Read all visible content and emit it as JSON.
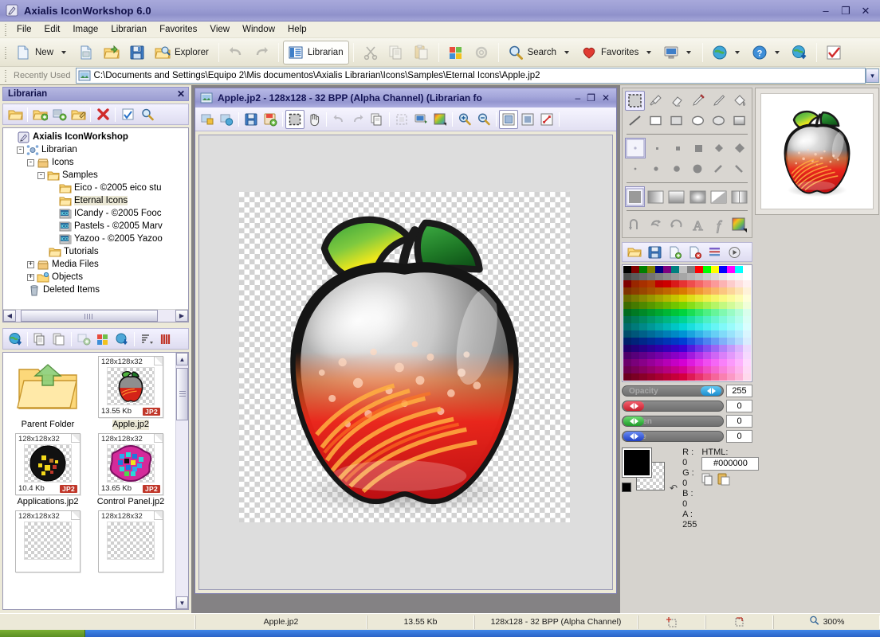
{
  "window": {
    "title": "Axialis IconWorkshop 6.0",
    "app_icon": "pen-icon",
    "minimize": "–",
    "restore": "❐",
    "close": "✕"
  },
  "menubar": {
    "items": [
      "File",
      "Edit",
      "Image",
      "Librarian",
      "Favorites",
      "View",
      "Window",
      "Help"
    ]
  },
  "toolbar": {
    "new_label": "New",
    "explorer_label": "Explorer",
    "librarian_label": "Librarian",
    "search_label": "Search",
    "favorites_label": "Favorites",
    "icons": [
      "new-document-icon",
      "new-dropdown-arrow",
      "new-from-image-icon",
      "open-folder-icon",
      "save-icon",
      "explorer-icon",
      "undo-icon",
      "redo-icon",
      "librarian-icon",
      "cut-icon",
      "copy-icon",
      "paste-icon",
      "windows-icon",
      "settings-icon",
      "search-icon",
      "favorites-heart-icon",
      "screen-icon",
      "globe-icon",
      "help-icon",
      "download-globe-icon",
      "checkmark-icon"
    ]
  },
  "address": {
    "label": "Recently Used",
    "path": "C:\\Documents and Settings\\Equipo 2\\Mis documentos\\Axialis Librarian\\Icons\\Samples\\Eternal Icons\\Apple.jp2",
    "dropdown_glyph": "▾"
  },
  "librarian_panel": {
    "caption": "Librarian",
    "close_glyph": "✕",
    "toolbar_icons": [
      "open-library-icon",
      "new-library-icon",
      "new-library-from-icon",
      "edit-library-icon",
      "delete-icon",
      "properties-icon",
      "find-icon"
    ],
    "tree": [
      {
        "indent": 0,
        "toggle": "",
        "icon": "pen-icon",
        "label": "Axialis IconWorkshop",
        "bold": true,
        "selected": false
      },
      {
        "indent": 1,
        "toggle": "-",
        "icon": "librarian-icon",
        "label": "Librarian",
        "bold": false,
        "selected": false
      },
      {
        "indent": 2,
        "toggle": "-",
        "icon": "box-icon",
        "label": "Icons",
        "bold": false,
        "selected": false
      },
      {
        "indent": 3,
        "toggle": "-",
        "icon": "folder-icon",
        "label": "Samples",
        "bold": false,
        "selected": false
      },
      {
        "indent": 4,
        "toggle": "",
        "icon": "folder-icon",
        "label": "Eico - ©2005 eico stu",
        "bold": false,
        "selected": false
      },
      {
        "indent": 4,
        "toggle": "",
        "icon": "folder-icon",
        "label": "Eternal Icons",
        "bold": false,
        "selected": true
      },
      {
        "indent": 4,
        "toggle": "",
        "icon": "ico-icon",
        "label": "ICandy - ©2005 Fooc",
        "bold": false,
        "selected": false
      },
      {
        "indent": 4,
        "toggle": "",
        "icon": "ico-icon",
        "label": "Pastels - ©2005 Marv",
        "bold": false,
        "selected": false
      },
      {
        "indent": 4,
        "toggle": "",
        "icon": "ico-icon",
        "label": "Yazoo - ©2005 Yazoo",
        "bold": false,
        "selected": false
      },
      {
        "indent": 3,
        "toggle": "",
        "icon": "folder-icon",
        "label": "Tutorials",
        "bold": false,
        "selected": false
      },
      {
        "indent": 2,
        "toggle": "+",
        "icon": "box-icon",
        "label": "Media Files",
        "bold": false,
        "selected": false
      },
      {
        "indent": 2,
        "toggle": "+",
        "icon": "objects-icon",
        "label": "Objects",
        "bold": false,
        "selected": false
      },
      {
        "indent": 1,
        "toggle": "",
        "icon": "trash-icon",
        "label": "Deleted Items",
        "bold": false,
        "selected": false
      }
    ]
  },
  "thumbnails": {
    "toolbar_icons": [
      "download-globe-icon",
      "copy-icon",
      "paste-icon",
      "add-to-library-icon",
      "windows-icon",
      "export-icon",
      "sort-icon",
      "view-details-icon"
    ],
    "items": [
      {
        "kind": "parent",
        "name": "Parent Folder",
        "dim": "",
        "size": "",
        "format": "",
        "selected": false,
        "art": "folder-up-icon"
      },
      {
        "kind": "icon",
        "name": "Apple.jp2",
        "dim": "128x128x32",
        "size": "13.55 Kb",
        "format": "JP2",
        "selected": true,
        "art": "apple-icon"
      },
      {
        "kind": "icon",
        "name": "Applications.jp2",
        "dim": "128x128x32",
        "size": "10.4 Kb",
        "format": "JP2",
        "selected": false,
        "art": "applications-icon"
      },
      {
        "kind": "icon",
        "name": "Control Panel.jp2",
        "dim": "128x128x32",
        "size": "13.65 Kb",
        "format": "JP2",
        "selected": false,
        "art": "control-panel-icon"
      },
      {
        "kind": "icon",
        "name": "",
        "dim": "128x128x32",
        "size": "",
        "format": "",
        "selected": false,
        "art": ""
      },
      {
        "kind": "icon",
        "name": "",
        "dim": "128x128x32",
        "size": "",
        "format": "",
        "selected": false,
        "art": ""
      }
    ],
    "scroll_up": "▲",
    "scroll_down": "▼"
  },
  "document": {
    "title": "Apple.jp2 - 128x128 - 32 BPP (Alpha Channel) (Librarian fo",
    "minimize": "–",
    "maximize": "❐",
    "close": "✕",
    "toolbar_icons": [
      "import-image-icon",
      "export-image-icon",
      "save-icon",
      "save-as-icon",
      "select-rect-icon",
      "pan-hand-icon",
      "undo-icon",
      "redo-icon",
      "copy-icon",
      "crop-icon",
      "preview-icon",
      "color-depth-icon",
      "zoom-in-icon",
      "zoom-out-icon",
      "view-normal-icon",
      "view-fit-icon",
      "view-stretch-icon"
    ],
    "zoom_display": "300%"
  },
  "tools_panel": {
    "row1": [
      "select-rect-icon",
      "eyedropper-icon",
      "eraser-icon",
      "pencil-icon",
      "brush-icon",
      "paint-bucket-icon"
    ],
    "row2": [
      "line-icon",
      "rectangle-icon",
      "filled-rectangle-icon",
      "ellipse-icon",
      "filled-ellipse-icon",
      "gradient-rect-icon"
    ],
    "brush_preview": "brush-preview",
    "brushes_row1": [
      "dot-1px",
      "square-2px",
      "square-4px",
      "square-6px",
      "diamond-3px",
      "diamond-5px"
    ],
    "brushes_row2": [
      "round-1px",
      "round-3px",
      "round-5px",
      "round-7px",
      "slash-icon",
      "backslash-icon"
    ],
    "fills": [
      "solid-fill",
      "linear-gradient-fill",
      "vertical-gradient-fill",
      "radial-gradient-fill",
      "diagonal-gradient-fill",
      "mirror-gradient-fill"
    ],
    "effects": [
      "rotate-flip-icon",
      "flip-horizontal-icon",
      "rotate-180-icon",
      "text-tool-icon",
      "effects-icon",
      "color-picker-icon"
    ],
    "palette_toolbar": [
      "open-palette-icon",
      "save-palette-icon",
      "new-palette-icon",
      "delete-palette-icon",
      "sort-palette-icon",
      "palette-options-icon"
    ]
  },
  "color_controls": {
    "opacity": {
      "label": "Opacity",
      "value": "255",
      "fill": 100,
      "color": "#3aa9e8"
    },
    "red": {
      "label": "Red",
      "value": "0",
      "fill": 0,
      "color": "#e23a4a"
    },
    "green": {
      "label": "Green",
      "value": "0",
      "fill": 0,
      "color": "#3ac24a"
    },
    "blue": {
      "label": "Blue",
      "value": "0",
      "fill": 0,
      "color": "#3a6ae2"
    },
    "r_line": "R :    0",
    "g_line": "G :    0",
    "b_line": "B :    0",
    "a_line": "A : 255",
    "html_label": "HTML:",
    "html_value": "#000000",
    "foreground": "#000000",
    "copy_icon": "copy-color-icon",
    "paste_icon": "paste-color-icon"
  },
  "preview": {
    "name": "apple-preview"
  },
  "statusbar": {
    "filename": "Apple.jp2",
    "filesize": "13.55 Kb",
    "format": "128x128 - 32 BPP (Alpha Channel)",
    "coord_icon": "crosshair-icon",
    "select_icon": "selection-size-icon",
    "zoom_icon": "magnifier-icon",
    "zoom": "300%"
  },
  "palette_colors": [
    "#000000",
    "#7f0000",
    "#007f00",
    "#7f7f00",
    "#00007f",
    "#7f007f",
    "#007f7f",
    "#c0c0c0",
    "#808080",
    "#ff0000",
    "#00ff00",
    "#ffff00",
    "#0000ff",
    "#ff00ff",
    "#00ffff",
    "#ffffff",
    "#4d4d4d",
    "#5a5a5a",
    "#666666",
    "#737373",
    "#808080",
    "#8c8c8c",
    "#999999",
    "#a6a6a6",
    "#b3b3b3",
    "#bfbfbf",
    "#cccccc",
    "#d9d9d9",
    "#e6e6e6",
    "#f2f2f2",
    "#f7f7f7",
    "#ffffff",
    "#7f0000",
    "#992600",
    "#a83000",
    "#b33a00",
    "#bf0000",
    "#cc0000",
    "#d91a1a",
    "#e63333",
    "#ef4d4d",
    "#f56666",
    "#f98080",
    "#fb9999",
    "#fcb3b3",
    "#fdcccc",
    "#fee0e0",
    "#fff0f0",
    "#7f3300",
    "#8c3d00",
    "#994700",
    "#a65200",
    "#b35c00",
    "#bf6600",
    "#cc7000",
    "#d97a00",
    "#e68a1a",
    "#f09933",
    "#f5a84d",
    "#f9b766",
    "#fbc680",
    "#fcd599",
    "#fde4b3",
    "#fef2d9",
    "#6b6b00",
    "#7a7a00",
    "#898900",
    "#989800",
    "#a7a700",
    "#b6b600",
    "#c5c500",
    "#d4d400",
    "#dede1a",
    "#e8e833",
    "#f0f04d",
    "#f5f566",
    "#f9f980",
    "#fbfb99",
    "#fdfdb3",
    "#fefed9",
    "#3d6b00",
    "#457a00",
    "#4e8900",
    "#569800",
    "#5fa700",
    "#67b600",
    "#70c500",
    "#78d400",
    "#86de1a",
    "#95e833",
    "#a6f04d",
    "#b4f566",
    "#c3f980",
    "#d2fb99",
    "#e0fdb3",
    "#f0fed9",
    "#006b1f",
    "#007a23",
    "#008928",
    "#00982c",
    "#00a730",
    "#00b635",
    "#00c539",
    "#00d43e",
    "#1ade55",
    "#33e86c",
    "#4df083",
    "#66f59a",
    "#80f9b0",
    "#99fbc5",
    "#b3fdd8",
    "#d9feec",
    "#006b4d",
    "#007a57",
    "#008961",
    "#00986b",
    "#00a775",
    "#00b67f",
    "#00c589",
    "#00d493",
    "#1adea3",
    "#33e8b3",
    "#4df0c2",
    "#66f5cf",
    "#80f9da",
    "#99fbe3",
    "#b3fdec",
    "#d9fef5",
    "#006b6b",
    "#007a7a",
    "#008989",
    "#009898",
    "#00a7a7",
    "#00b6b6",
    "#00c5c5",
    "#00d4d4",
    "#1adede",
    "#33e8e8",
    "#4df0f0",
    "#66f5f5",
    "#80f9f9",
    "#99fbfb",
    "#b3fdfd",
    "#d9fefe",
    "#004d6b",
    "#00577a",
    "#006189",
    "#006b98",
    "#0075a7",
    "#007fb6",
    "#0089c5",
    "#0093d4",
    "#1aa3de",
    "#33b3e8",
    "#4dc2f0",
    "#66cff5",
    "#80daf9",
    "#99e3fb",
    "#b3ecfd",
    "#d9f5fe",
    "#001f6b",
    "#00237a",
    "#002889",
    "#002c98",
    "#0030a7",
    "#0035b6",
    "#0039c5",
    "#003ed4",
    "#1a55de",
    "#336ce8",
    "#4d83f0",
    "#669af5",
    "#80b0f9",
    "#99c5fb",
    "#b3d8fd",
    "#d9ecfe",
    "#1f006b",
    "#23007a",
    "#280089",
    "#2c0098",
    "#3000a7",
    "#3500b6",
    "#3900c5",
    "#3e00d4",
    "#551ade",
    "#6c33e8",
    "#834df0",
    "#9a66f5",
    "#b080f9",
    "#c599fb",
    "#d8b3fd",
    "#ecd9fe",
    "#4d006b",
    "#57007a",
    "#610089",
    "#6b0098",
    "#7500a7",
    "#7f00b6",
    "#8900c5",
    "#9300d4",
    "#a31ade",
    "#b333e8",
    "#c24df0",
    "#cf66f5",
    "#da80f9",
    "#e399fb",
    "#ecb3fd",
    "#f5d9fe",
    "#6b006b",
    "#7a007a",
    "#890089",
    "#980098",
    "#a700a7",
    "#b600b6",
    "#c500c5",
    "#d400d4",
    "#de1ade",
    "#e833e8",
    "#f04df0",
    "#f566f5",
    "#f980f9",
    "#fb99fb",
    "#fdb3fd",
    "#fed9fe",
    "#6b004d",
    "#7a0057",
    "#890061",
    "#98006b",
    "#a70075",
    "#b6007f",
    "#c50089",
    "#d40093",
    "#de1aa3",
    "#e833b3",
    "#f04dc2",
    "#f566cf",
    "#f980da",
    "#fb99e3",
    "#fdb3ec",
    "#fed9f5",
    "#6b001f",
    "#7a0023",
    "#890028",
    "#98002c",
    "#a70030",
    "#b60035",
    "#c50039",
    "#d4003e",
    "#de1a55",
    "#e8336c",
    "#f04d83",
    "#f5669a",
    "#f980b0",
    "#fb99c5",
    "#fdb3d8",
    "#fed9ec"
  ]
}
